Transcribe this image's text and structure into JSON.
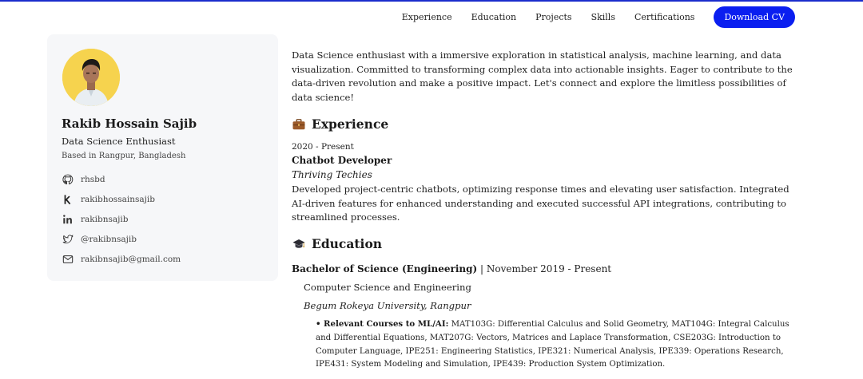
{
  "nav": {
    "links": [
      "Experience",
      "Education",
      "Projects",
      "Skills",
      "Certifications"
    ],
    "cta": "Download CV"
  },
  "profile": {
    "name": "Rakib Hossain Sajib",
    "role": "Data Science Enthusiast",
    "location": "Based in Rangpur, Bangladesh",
    "socials": [
      {
        "icon": "github-icon",
        "text": "rhsbd"
      },
      {
        "icon": "kaggle-icon",
        "text": "rakibhossainsajib"
      },
      {
        "icon": "linkedin-icon",
        "text": "rakibnsajib"
      },
      {
        "icon": "twitter-icon",
        "text": "@rakibnsajib"
      },
      {
        "icon": "email-icon",
        "text": "rakibnsajib@gmail.com"
      }
    ]
  },
  "intro": "Data Science enthusiast with a immersive exploration in statistical analysis, machine learning, and data visualization. Committed to transforming complex data into actionable insights. Eager to contribute to the data-driven revolution and make a positive impact. Let's connect and explore the limitless possibilities of data science!",
  "experience": {
    "heading": "Experience",
    "date": "2020 - Present",
    "title": "Chatbot Developer",
    "company": "Thriving Techies",
    "description": "Developed project-centric chatbots, optimizing response times and elevating user satisfaction. Integrated AI-driven features for enhanced understanding and executed successful API integrations, contributing to streamlined processes."
  },
  "education": {
    "heading": "Education",
    "degree": "Bachelor of Science (Engineering)",
    "period": "| November 2019 - Present",
    "major": "Computer Science and Engineering",
    "university": "Begum Rokeya University, Rangpur",
    "courses_label": "• Relevant Courses to ML/AI:",
    "courses": "MAT103G: Differential Calculus and Solid Geometry, MAT104G: Integral Calculus and Differential Equations, MAT207G: Vectors, Matrices and Laplace Transformation, CSE203G: Introduction to Computer Language, IPE251: Engineering Statistics, IPE321: Numerical Analysis, IPE339: Operations Research, IPE431: System Modeling and Simulation, IPE439: Production System Optimization."
  },
  "colors": {
    "accent": "#0a1ef0",
    "card_bg": "#f6f7f9",
    "avatar_bg": "#f6d34e"
  }
}
